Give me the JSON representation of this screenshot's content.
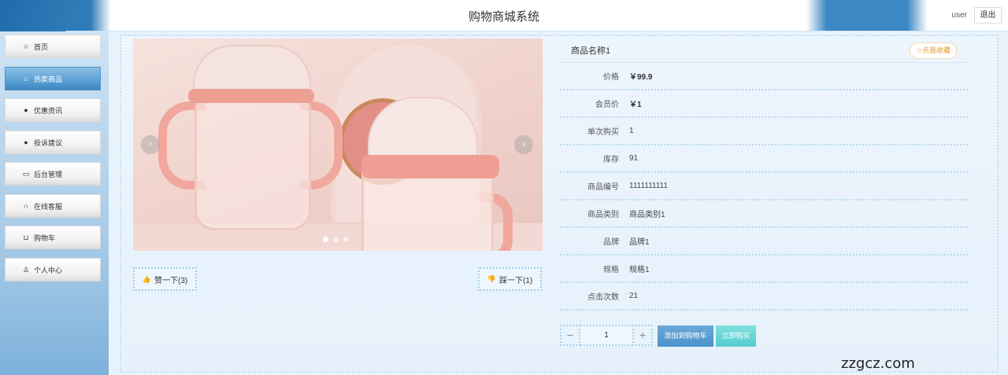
{
  "header": {
    "title": "购物商城系统",
    "user": "user",
    "logout_label": "退出"
  },
  "sidebar": {
    "items": [
      {
        "label": "首页",
        "icon": "star-icon"
      },
      {
        "label": "热卖商品",
        "icon": "lock-icon"
      },
      {
        "label": "优惠资讯",
        "icon": "info-icon"
      },
      {
        "label": "投诉建议",
        "icon": "question-icon"
      },
      {
        "label": "后台管理",
        "icon": "briefcase-icon"
      },
      {
        "label": "在线客服",
        "icon": "headset-icon"
      },
      {
        "label": "购物车",
        "icon": "cart-icon"
      },
      {
        "label": "个人中心",
        "icon": "user-icon"
      }
    ],
    "active_index": 1
  },
  "carousel": {
    "prev_glyph": "‹",
    "next_glyph": "›",
    "slide_count": 3,
    "active_slide": 1
  },
  "votes": {
    "like_label": "赞一下(3)",
    "dislike_label": "踩一下(1)"
  },
  "product": {
    "name": "商品名称1",
    "favorite_label": "☆点我收藏",
    "fields": [
      {
        "label": "价格",
        "value": "￥99.9",
        "bold": true
      },
      {
        "label": "会员价",
        "value": "￥1",
        "bold": true
      },
      {
        "label": "单次购买",
        "value": "1"
      },
      {
        "label": "库存",
        "value": "91"
      },
      {
        "label": "商品编号",
        "value": "1111111111"
      },
      {
        "label": "商品类别",
        "value": "商品类别1"
      },
      {
        "label": "品牌",
        "value": "品牌1"
      },
      {
        "label": "规格",
        "value": "规格1"
      },
      {
        "label": "点击次数",
        "value": "21"
      }
    ]
  },
  "purchase": {
    "minus": "−",
    "quantity": "1",
    "plus": "+",
    "add_to_cart_label": "添加到购物车",
    "buy_now_label": "立即购买"
  },
  "watermark": "zzgcz.com",
  "colors": {
    "accent": "#4d92cc",
    "buy": "#55ccd0",
    "favorite": "#e6982e"
  }
}
